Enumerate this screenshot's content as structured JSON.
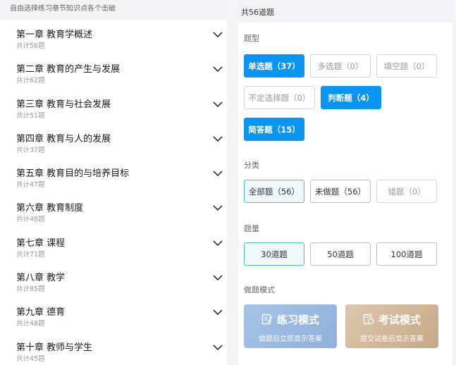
{
  "left": {
    "header": "自由选择练习章节知识点各个击破",
    "chapters": [
      {
        "title": "第一章 教育学概述",
        "count": "共计56题"
      },
      {
        "title": "第二章 教育的产生与发展",
        "count": "共计62题"
      },
      {
        "title": "第三章 教育与社会发展",
        "count": "共计51题"
      },
      {
        "title": "第四章 教育与人的发展",
        "count": "共计37题"
      },
      {
        "title": "第五章 教育目的与培养目标",
        "count": "共计47题"
      },
      {
        "title": "第六章 教育制度",
        "count": "共计48题"
      },
      {
        "title": "第七章 课程",
        "count": "共计71题"
      },
      {
        "title": "第八章 教学",
        "count": "共计85题"
      },
      {
        "title": "第九章 德育",
        "count": "共计48题"
      },
      {
        "title": "第十章 教师与学生",
        "count": "共计45题"
      }
    ]
  },
  "right": {
    "header": "共56道题",
    "type_label": "题型",
    "types": [
      {
        "label": "单选题（37）"
      },
      {
        "label": "多选题（0）"
      },
      {
        "label": "填空题（0）"
      },
      {
        "label": "不定选择题（0）"
      },
      {
        "label": "判断题（4）"
      },
      {
        "label": "简答题（15）"
      }
    ],
    "category_label": "分类",
    "categories": [
      {
        "label": "全部题（56）"
      },
      {
        "label": "未做题（56）"
      },
      {
        "label": "错题（0）"
      }
    ],
    "amount_label": "题量",
    "amounts": [
      {
        "label": "30道题"
      },
      {
        "label": "50道题"
      },
      {
        "label": "100道题"
      }
    ],
    "mode_label": "做题模式",
    "practice": {
      "title": "练习模式",
      "sub": "做题后立即显示答案"
    },
    "exam": {
      "title": "考试模式",
      "sub": "提交试卷后显示答案"
    }
  },
  "colors": {
    "primary": "#0a95f2",
    "practice": "#9dbbe1",
    "exam": "#d4b999"
  }
}
